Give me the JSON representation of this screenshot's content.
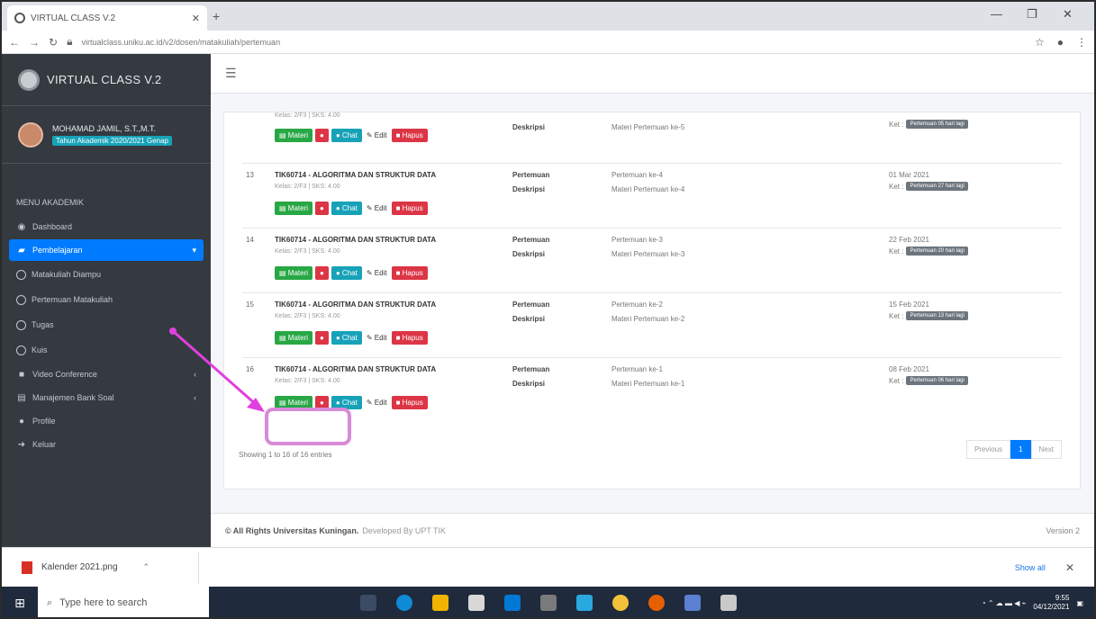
{
  "browser": {
    "tab_title": "VIRTUAL CLASS V.2",
    "url": "virtualclass.uniku.ac.id/v2/dosen/matakuliah/pertemuan"
  },
  "sidebar": {
    "brand": "VIRTUAL CLASS V.2",
    "user_name": "MOHAMAD JAMIL, S.T.,M.T.",
    "user_badge": "Tahun Akademik 2020/2021 Genap",
    "menu_header": "MENU AKADEMIK",
    "items": [
      {
        "label": "Dashboard",
        "icon": "dashboard-icon"
      },
      {
        "label": "Pembelajaran",
        "icon": "book-icon",
        "active": true
      },
      {
        "label": "Matakuliah Diampu",
        "icon": "circle-icon"
      },
      {
        "label": "Pertemuan Matakuliah",
        "icon": "circle-icon"
      },
      {
        "label": "Tugas",
        "icon": "circle-icon"
      },
      {
        "label": "Kuis",
        "icon": "circle-icon"
      },
      {
        "label": "Video Conference",
        "icon": "video-icon"
      },
      {
        "label": "Manajemen Bank Soal",
        "icon": "database-icon"
      },
      {
        "label": "Profile",
        "icon": "user-icon"
      },
      {
        "label": "Keluar",
        "icon": "signout-icon"
      }
    ]
  },
  "table": {
    "rows": [
      {
        "no": "",
        "course": "",
        "sub": "Kelas: 2/F3 | SKS: 4.00",
        "pert_label": "",
        "pert_val": "",
        "desk_label": "Deskripsi",
        "desk_val": "Materi Pertemuan ke-5",
        "date": "",
        "ket_label": "Ket :",
        "ket_pill": "Pertemuan 05 hari lagi"
      },
      {
        "no": "13",
        "course": "TIK60714 - ALGORITMA DAN STRUKTUR DATA",
        "sub": "Kelas: 2/F3 | SKS: 4.00",
        "pert_label": "Pertemuan",
        "pert_val": "Pertemuan ke-4",
        "desk_label": "Deskripsi",
        "desk_val": "Materi Pertemuan ke-4",
        "date": "01 Mar 2021",
        "ket_label": "Ket :",
        "ket_pill": "Pertemuan 27 hari lagi"
      },
      {
        "no": "14",
        "course": "TIK60714 - ALGORITMA DAN STRUKTUR DATA",
        "sub": "Kelas: 2/F3 | SKS: 4.00",
        "pert_label": "Pertemuan",
        "pert_val": "Pertemuan ke-3",
        "desk_label": "Deskripsi",
        "desk_val": "Materi Pertemuan ke-3",
        "date": "22 Feb 2021",
        "ket_label": "Ket :",
        "ket_pill": "Pertemuan 20 hari lagi"
      },
      {
        "no": "15",
        "course": "TIK60714 - ALGORITMA DAN STRUKTUR DATA",
        "sub": "Kelas: 2/F3 | SKS: 4.00",
        "pert_label": "Pertemuan",
        "pert_val": "Pertemuan ke-2",
        "desk_label": "Deskripsi",
        "desk_val": "Materi Pertemuan ke-2",
        "date": "15 Feb 2021",
        "ket_label": "Ket :",
        "ket_pill": "Pertemuan 13 hari lagi"
      },
      {
        "no": "16",
        "course": "TIK60714 - ALGORITMA DAN STRUKTUR DATA",
        "sub": "Kelas: 2/F3 | SKS: 4.00",
        "pert_label": "Pertemuan",
        "pert_val": "Pertemuan ke-1",
        "desk_label": "Deskripsi",
        "desk_val": "Materi Pertemuan ke-1",
        "date": "08 Feb 2021",
        "ket_label": "Ket :",
        "ket_pill": "Pertemuan 06 hari lagi"
      }
    ],
    "buttons": {
      "materi": "Materi",
      "chat": "Chat",
      "edit": "Edit",
      "hapus": "Hapus"
    },
    "showing": "Showing 1 to 16 of 16 entries",
    "pager": {
      "prev": "Previous",
      "page": "1",
      "next": "Next"
    }
  },
  "footer": {
    "copyright": "© All Rights Universitas Kuningan.",
    "developed": "Developed By UPT TIK",
    "version": "Version 2"
  },
  "download": {
    "file": "Kalender 2021.png",
    "show_all": "Show all"
  },
  "taskbar": {
    "search": "Type here to search",
    "time": "9:55",
    "date": "04/12/2021"
  },
  "colors": {
    "sidebar": "#343a40",
    "primary": "#007bff",
    "success": "#28a745",
    "danger": "#dc3545",
    "info": "#17a2b8",
    "highlight": "#d78bd8",
    "arrow": "#e040e0"
  }
}
